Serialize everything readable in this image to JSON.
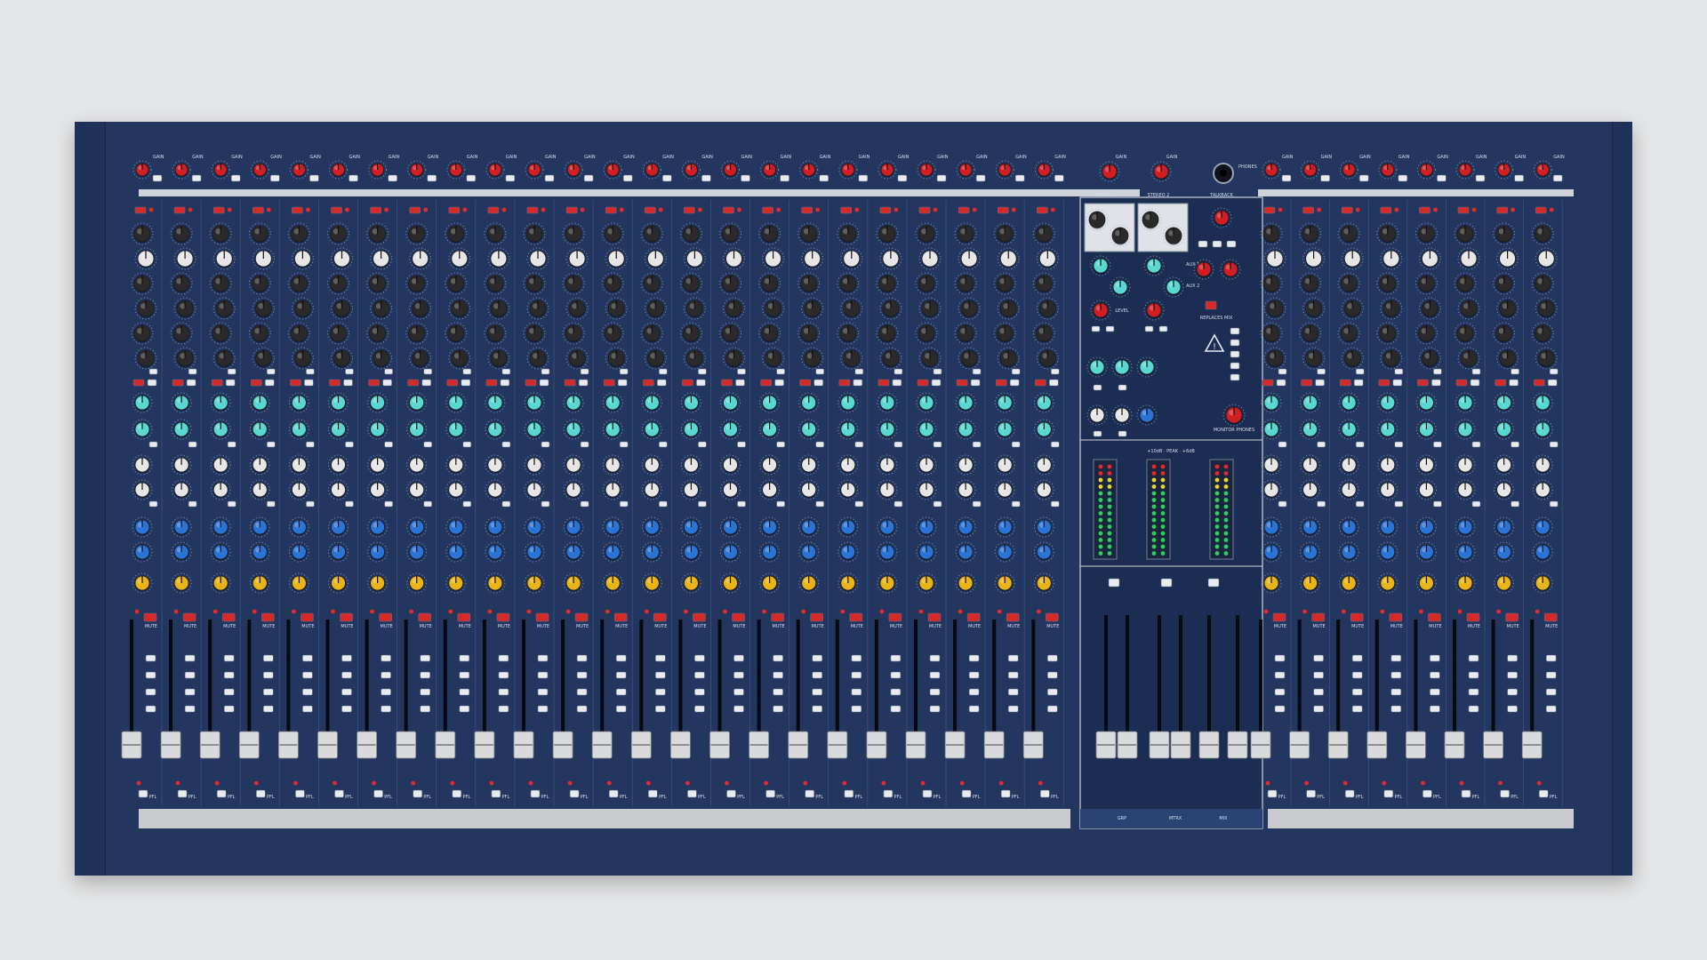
{
  "colors": {
    "panel": "#22365f",
    "panel_dark": "#1b2d52",
    "strip_line": "#3a5283",
    "knob_red": "#d21e22",
    "knob_cyan": "#58d8d0",
    "knob_white": "#e6e6e6",
    "knob_blue": "#2a74d8",
    "knob_yellow": "#e8b419",
    "knob_dark": "#2a2a2a",
    "button_white": "#e9ebef",
    "button_red": "#d42a2a",
    "led_green": "#2bd15b",
    "led_yellow": "#f0d22a",
    "led_red": "#e62a2a",
    "fader_cap": "#d9dadc",
    "scribble": "#c9cbce"
  },
  "icons": {
    "warning": "warning-triangle-icon",
    "phones": "headphone-jack-icon"
  },
  "labels": {
    "gain": "GAIN",
    "mute": "MUTE",
    "pfl": "PFL",
    "stereo1": "STEREO 1",
    "stereo2": "STEREO 2",
    "talkback": "TALKBACK",
    "phones": "PHONES",
    "level": "LEVEL",
    "aux1": "AUX 1",
    "aux2": "AUX 2",
    "replaces_mix": "REPLACES MIX",
    "monitor_phones": "MONITOR PHONES",
    "grp": "GRP",
    "mix": "MIX",
    "mtrx": "MTRX",
    "meter_top": "+10dB · PEAK · +6dB"
  }
}
